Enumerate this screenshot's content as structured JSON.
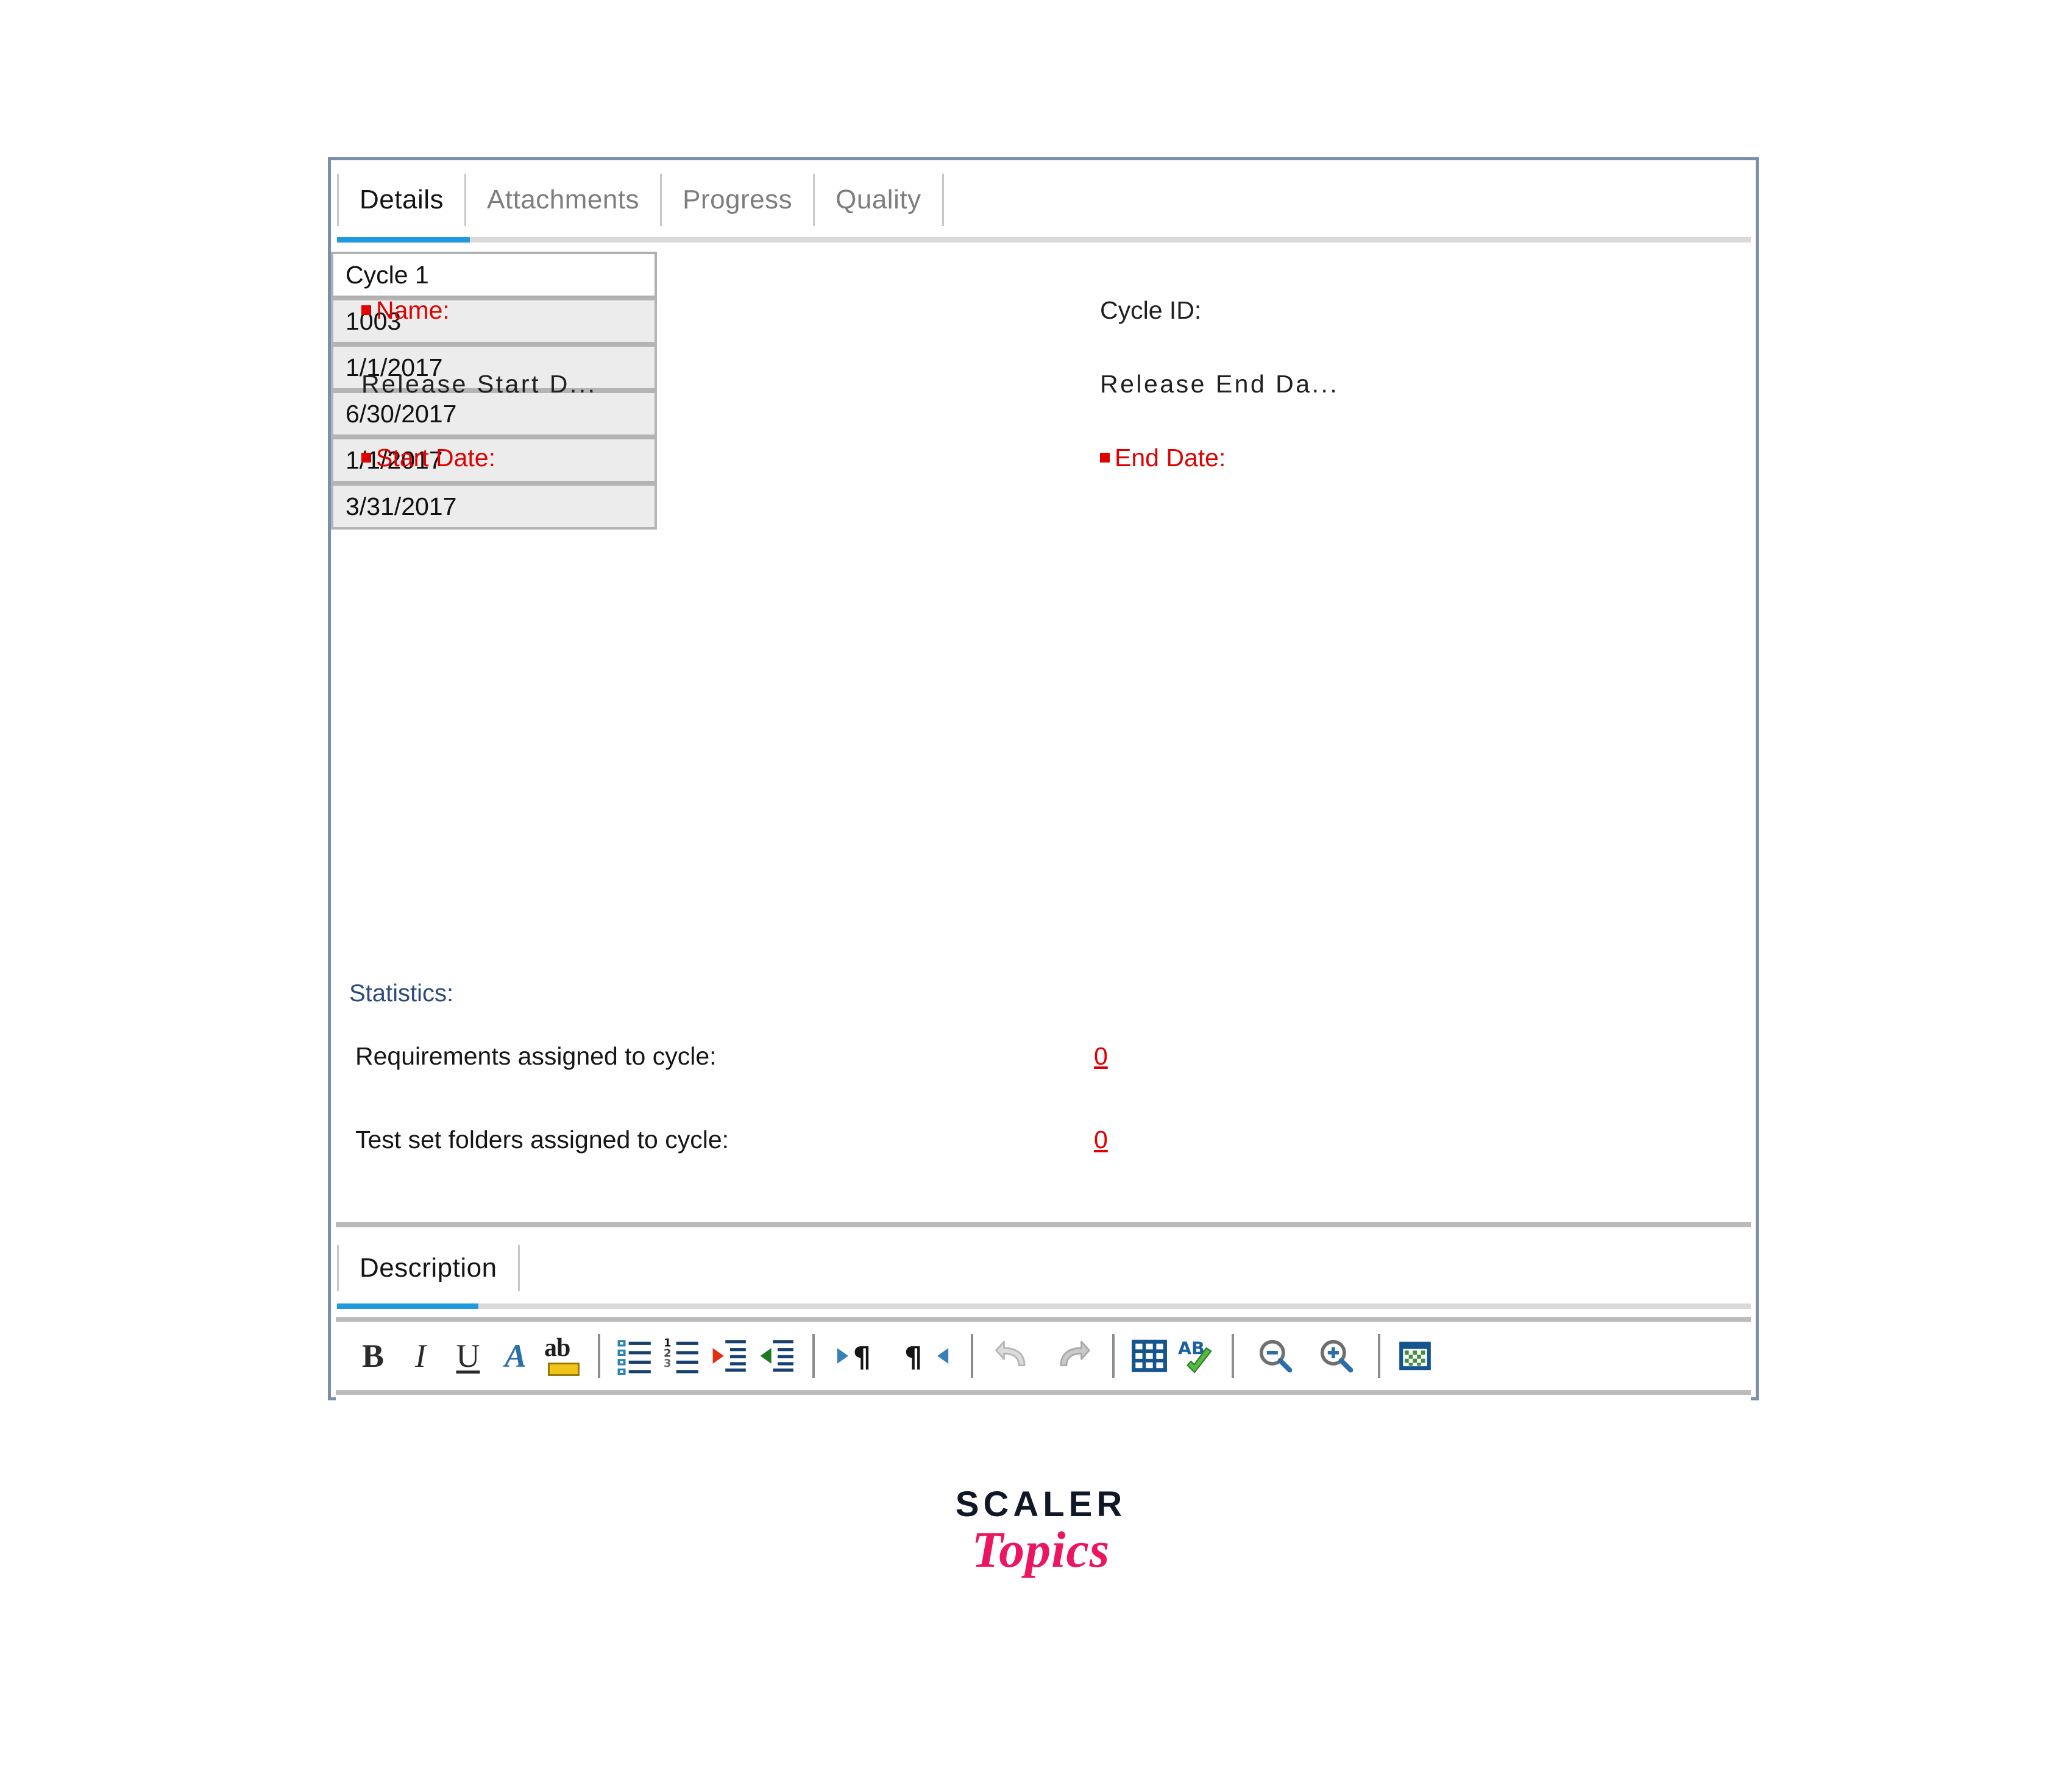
{
  "dialog": {
    "tabs": [
      {
        "label": "Details",
        "active": true
      },
      {
        "label": "Attachments",
        "active": false
      },
      {
        "label": "Progress",
        "active": false
      },
      {
        "label": "Quality",
        "active": false
      }
    ],
    "accent_color": "#1f9bdd",
    "border_color": "#7b8ead"
  },
  "form": {
    "name": {
      "label": "Name:",
      "required": true,
      "value": "Cycle 1",
      "editable": true
    },
    "cycle_id": {
      "label": "Cycle ID:",
      "required": false,
      "value": "1003",
      "editable": false
    },
    "release_start_date": {
      "label": "Release  Start  D...",
      "required": false,
      "value": "1/1/2017",
      "editable": false
    },
    "release_end_date": {
      "label": "Release  End  Da...",
      "required": false,
      "value": "6/30/2017",
      "editable": false
    },
    "start_date": {
      "label": "Start Date:",
      "required": true,
      "value": "1/1/2017",
      "editable": false
    },
    "end_date": {
      "label": "End Date:",
      "required": true,
      "value": "3/31/2017",
      "editable": false
    }
  },
  "statistics": {
    "title": "Statistics:",
    "rows": [
      {
        "label": "Requirements assigned to cycle:",
        "value": "0"
      },
      {
        "label": "Test set folders assigned to cycle:",
        "value": "0"
      }
    ],
    "value_color": "#e00000",
    "title_color": "#2a4b7c"
  },
  "description": {
    "tabs": [
      {
        "label": "Description",
        "active": true
      }
    ],
    "body_text": "",
    "toolbar": [
      {
        "name": "bold",
        "glyph": "B"
      },
      {
        "name": "italic",
        "glyph": "I"
      },
      {
        "name": "underline",
        "glyph": "U"
      },
      {
        "name": "font-color",
        "glyph": "A"
      },
      {
        "name": "text-highlight",
        "glyph": "ab"
      },
      {
        "name": "separator-1",
        "glyph": ""
      },
      {
        "name": "bulleted-list",
        "glyph": ""
      },
      {
        "name": "numbered-list",
        "glyph": ""
      },
      {
        "name": "increase-indent",
        "glyph": ""
      },
      {
        "name": "decrease-indent",
        "glyph": ""
      },
      {
        "name": "separator-2",
        "glyph": ""
      },
      {
        "name": "ltr-direction",
        "glyph": ""
      },
      {
        "name": "rtl-direction",
        "glyph": ""
      },
      {
        "name": "separator-3",
        "glyph": ""
      },
      {
        "name": "undo",
        "glyph": ""
      },
      {
        "name": "redo",
        "glyph": ""
      },
      {
        "name": "separator-4",
        "glyph": ""
      },
      {
        "name": "insert-table",
        "glyph": ""
      },
      {
        "name": "spell-check",
        "glyph": ""
      },
      {
        "name": "separator-5",
        "glyph": ""
      },
      {
        "name": "zoom-out",
        "glyph": ""
      },
      {
        "name": "zoom-in",
        "glyph": ""
      },
      {
        "name": "separator-6",
        "glyph": ""
      },
      {
        "name": "insert-object",
        "glyph": ""
      }
    ]
  },
  "watermark": {
    "line1": "SCALER",
    "line2": "Topics",
    "line1_color": "#101828",
    "line2_color": "#ec1561"
  }
}
